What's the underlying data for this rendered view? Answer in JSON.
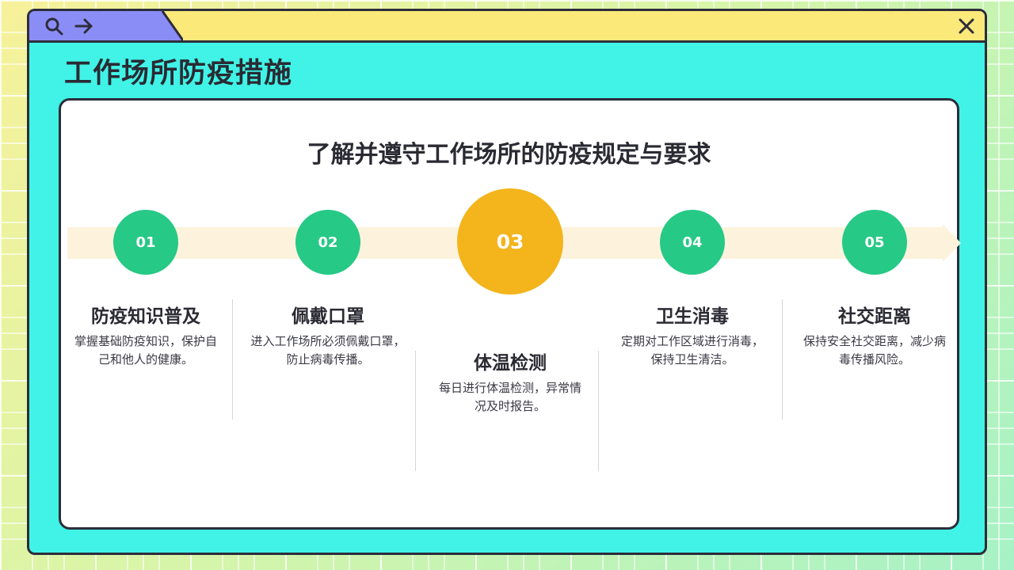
{
  "window": {
    "page_title": "工作场所防疫措施",
    "icons": [
      "search-icon",
      "arrow-right-icon",
      "close-icon"
    ]
  },
  "content": {
    "subtitle": "了解并遵守工作场所的防疫规定与要求",
    "steps": [
      {
        "number": "01",
        "title": "防疫知识普及",
        "desc_line1": "掌握基础防疫知识，保护自",
        "desc_line2": "己和他人的健康。"
      },
      {
        "number": "02",
        "title": "佩戴口罩",
        "desc_line1": "进入工作场所必须佩戴口罩，",
        "desc_line2": "防止病毒传播。"
      },
      {
        "number": "03",
        "title": "体温检测",
        "desc_line1": "每日进行体温检测，异常情",
        "desc_line2": "况及时报告。"
      },
      {
        "number": "04",
        "title": "卫生消毒",
        "desc_line1": "定期对工作区域进行消毒，",
        "desc_line2": "保持卫生清洁。"
      },
      {
        "number": "05",
        "title": "社交距离",
        "desc_line1": "保持安全社交距离，减少病",
        "desc_line2": "毒传播风险。"
      }
    ]
  },
  "colors": {
    "window_bg": "#40f3e6",
    "titlebar_purple": "#8b8df7",
    "titlebar_yellow": "#fbe97a",
    "step_green": "#26c986",
    "step_highlight": "#f3b41c",
    "arrow_band": "#fdf3dc"
  }
}
